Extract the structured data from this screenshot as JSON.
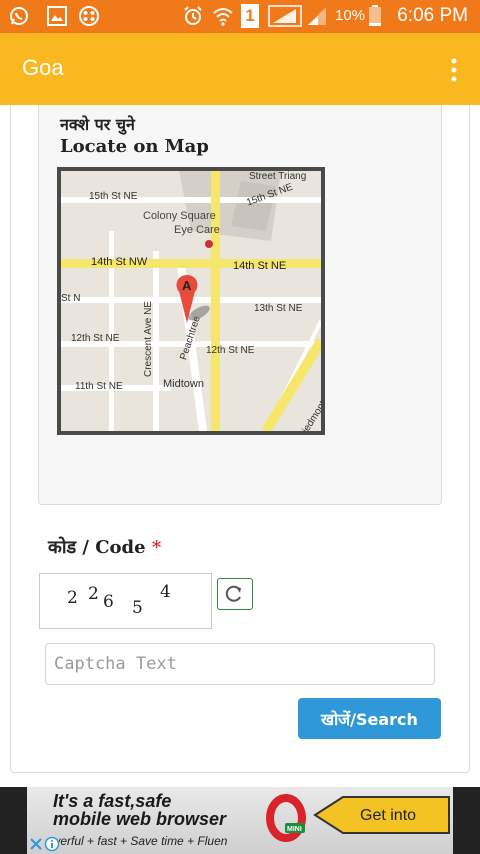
{
  "status_bar": {
    "battery": "10%",
    "sim_slot": "1",
    "time": "6:06 PM",
    "icons": [
      "whatsapp-icon",
      "gallery-icon",
      "app-icon",
      "alarm-icon",
      "wifi-icon",
      "sim-icon",
      "signal-icon",
      "signal-icon",
      "battery-icon"
    ]
  },
  "app_bar": {
    "title": "Goa",
    "menu_icon": "more-vert-icon"
  },
  "map_section": {
    "label_hindi": "नक्शे पर चुने",
    "label_english": "Locate on Map",
    "map": {
      "marker_label": "A",
      "streets": [
        "15th St NE",
        "Street Triang",
        "15th St NE",
        "Colony Square",
        "Eye Care",
        "14th St NW",
        "14th St NE",
        "St N",
        "13th St NE",
        "Crescent Ave NE",
        "Peachtree",
        "12th St NE",
        "12th St NE",
        "11th St NE",
        "Midtown",
        "Piedmont Ave NE"
      ]
    }
  },
  "code_section": {
    "label": "कोड / Code",
    "required_mark": "*",
    "captcha_chars": [
      "2",
      "2",
      "6",
      "5",
      "4"
    ],
    "refresh_icon": "refresh-icon"
  },
  "captcha_input": {
    "placeholder": "Captcha Text",
    "value": ""
  },
  "search_button": {
    "label": "खोजें/Search"
  },
  "ad": {
    "headline_1": "It's a fast,safe",
    "headline_2": "mobile web browser",
    "subtext": "owerful + fast + Save time + Fluen",
    "logo_text": "MINI",
    "cta": "Get into"
  },
  "colors": {
    "status_bar": "#f07a19",
    "app_bar": "#f9b820",
    "search_button": "#2f98d8",
    "required": "#d9302a",
    "refresh_border": "#2e8b3e"
  }
}
